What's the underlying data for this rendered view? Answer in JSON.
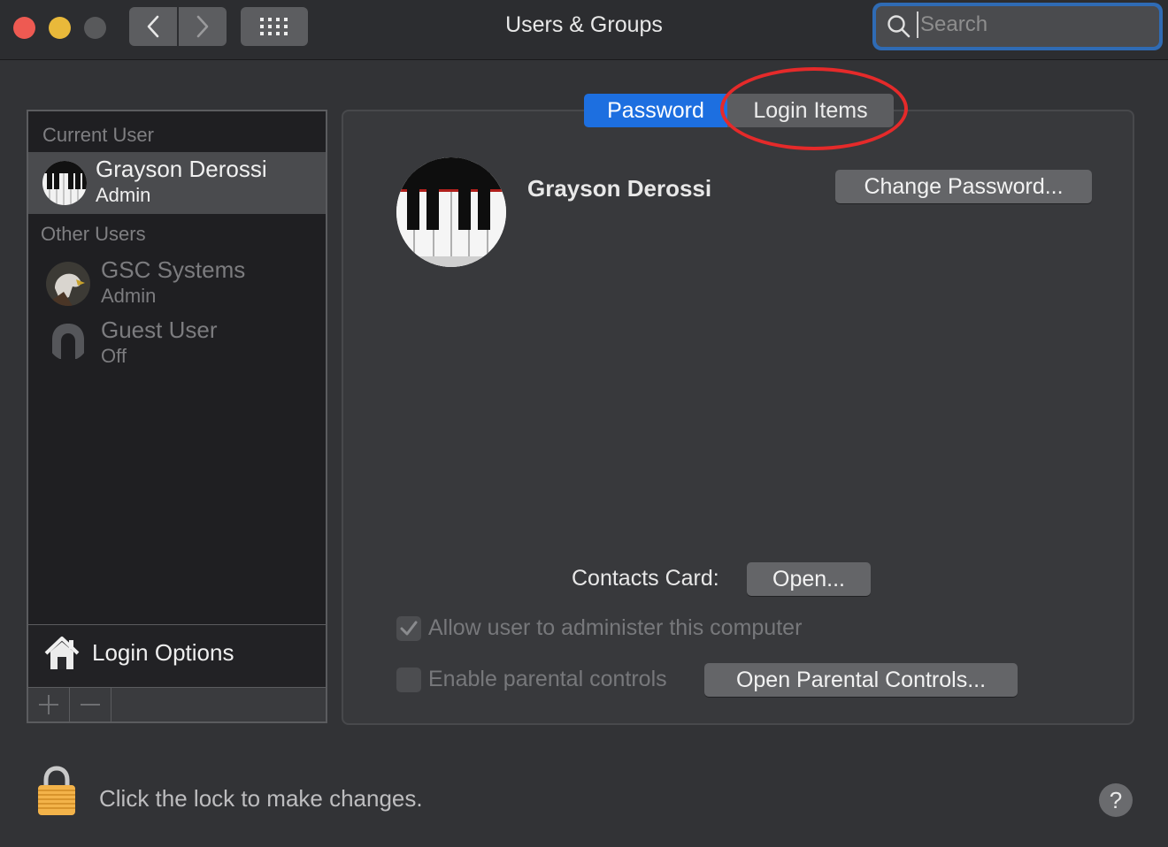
{
  "window": {
    "title": "Users & Groups",
    "search_placeholder": "Search"
  },
  "sidebar": {
    "current_user_header": "Current User",
    "current_user": {
      "name": "Grayson Derossi",
      "role": "Admin"
    },
    "other_users_header": "Other Users",
    "other_users": [
      {
        "name": "GSC Systems",
        "role": "Admin"
      },
      {
        "name": "Guest User",
        "role": "Off"
      }
    ],
    "login_options_label": "Login Options",
    "add_label": "+",
    "remove_label": "—"
  },
  "tabs": {
    "password": "Password",
    "login_items": "Login Items",
    "selected": "password"
  },
  "main": {
    "user_name": "Grayson Derossi",
    "change_password_label": "Change Password...",
    "contacts_card_label": "Contacts Card:",
    "open_label": "Open...",
    "allow_admin_label": "Allow user to administer this computer",
    "allow_admin_checked": true,
    "parental_label": "Enable parental controls",
    "parental_checked": false,
    "open_parental_label": "Open Parental Controls..."
  },
  "footer": {
    "lock_text": "Click the lock to make changes.",
    "help_label": "?"
  },
  "colors": {
    "accent": "#1d6fe0",
    "annotation": "#e52a2a",
    "close": "#ee5a52",
    "minimize": "#e9b93a"
  }
}
